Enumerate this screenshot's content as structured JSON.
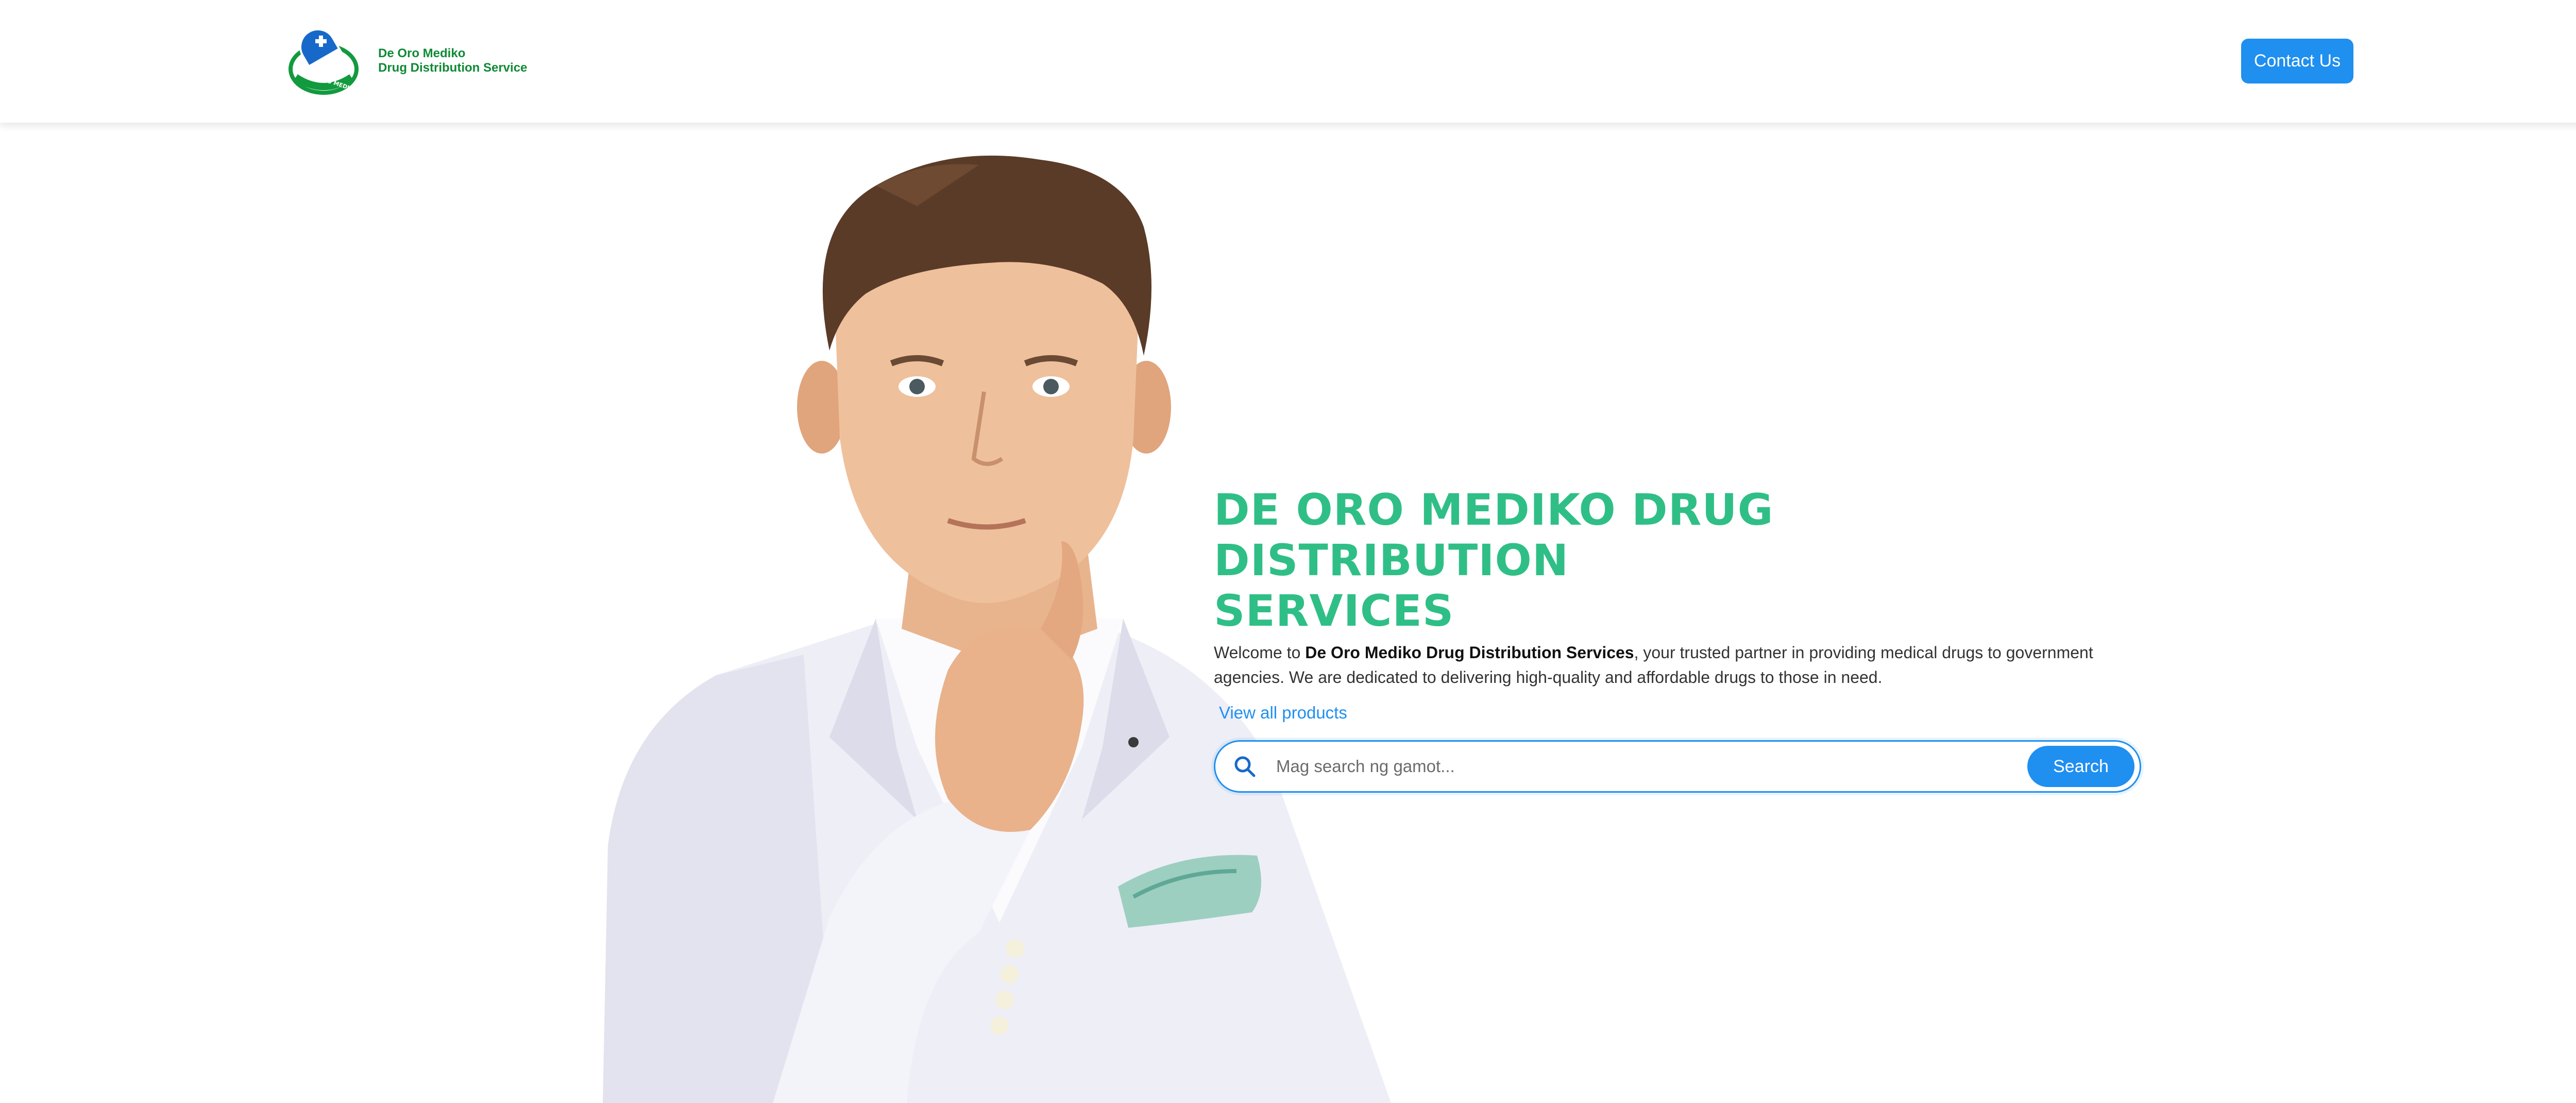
{
  "navbar": {
    "brand_line1": "De Oro Mediko",
    "brand_line2": "Drug Distribution Service",
    "logo_badge_text": "DE ORO MEDIKO",
    "contact_label": "Contact Us"
  },
  "hero": {
    "title": "DE ORO MEDIKO DRUG DISTRIBUTION SERVICES",
    "desc_prefix": "Welcome to ",
    "desc_bold": "De Oro Mediko Drug Distribution Services",
    "desc_suffix": ", your trusted partner in providing medical drugs to government agencies. We are dedicated to delivering high-quality and affordable drugs to those in need.",
    "view_all_label": "View all products",
    "image_subject": "man in white blazer, hand on chin"
  },
  "search": {
    "placeholder": "Mag search ng gamot...",
    "value": "",
    "button_label": "Search"
  },
  "colors": {
    "brand_green": "#0f8a36",
    "title_green": "#2fbf86",
    "accent_blue": "#1f8ff0",
    "logo_blue": "#1769c9"
  },
  "icons": {
    "logo": "pill-cross-logo",
    "search": "search-icon"
  }
}
